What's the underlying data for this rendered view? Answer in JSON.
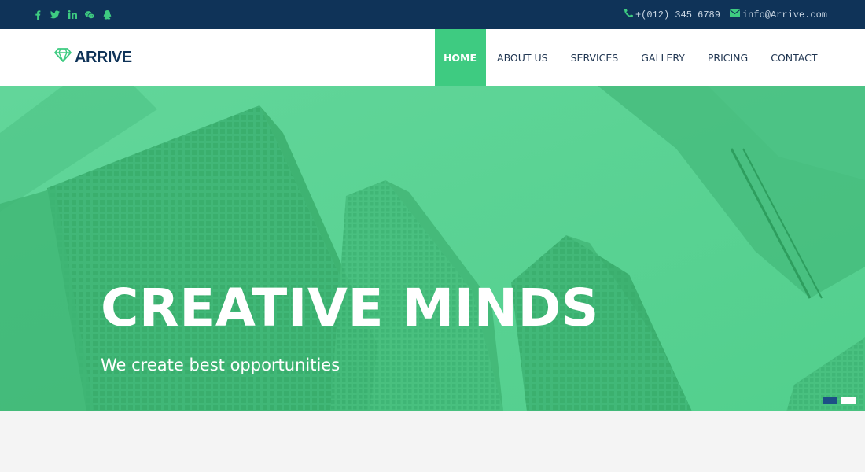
{
  "topbar": {
    "social": [
      {
        "name": "facebook-icon",
        "glyph": "f"
      },
      {
        "name": "twitter-icon",
        "glyph": "t"
      },
      {
        "name": "linkedin-icon",
        "glyph": "in"
      },
      {
        "name": "wechat-icon",
        "glyph": "w"
      },
      {
        "name": "qq-icon",
        "glyph": "q"
      }
    ],
    "phone": "+(012) 345 6789",
    "email": "info@Arrive.com"
  },
  "brand": {
    "name": "ARRIVE",
    "logo_icon": "diamond-icon"
  },
  "nav": {
    "items": [
      {
        "label": "HOME",
        "active": true
      },
      {
        "label": "ABOUT US",
        "active": false
      },
      {
        "label": "SERVICES",
        "active": false
      },
      {
        "label": "GALLERY",
        "active": false
      },
      {
        "label": "PRICING",
        "active": false
      },
      {
        "label": "CONTACT",
        "active": false
      }
    ]
  },
  "hero": {
    "title": "CREATIVE MINDS",
    "subtitle": "We create best opportunities",
    "slides_total": 2,
    "active_slide": 1
  },
  "colors": {
    "topbar_bg": "#0f3358",
    "accent": "#3ecb81",
    "hero_overlay": "#5ad393",
    "brand_text": "#0f3358"
  }
}
